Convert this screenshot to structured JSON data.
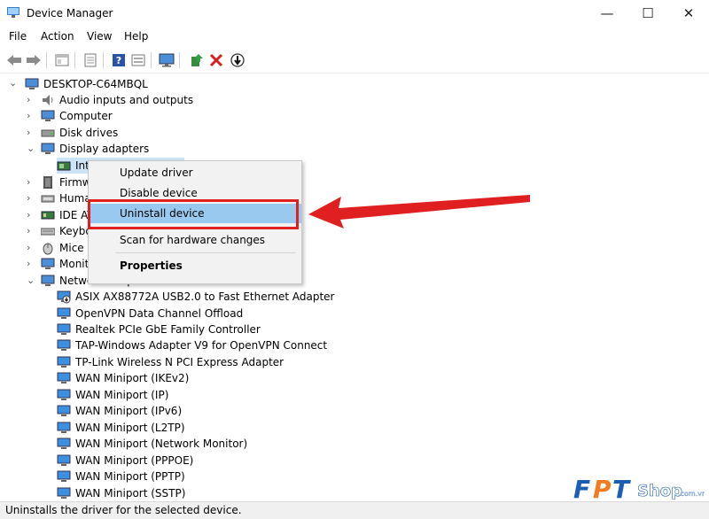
{
  "window": {
    "title": "Device Manager",
    "min_symbol": "—",
    "max_symbol": "☐",
    "close_symbol": "✕"
  },
  "menu": {
    "items": [
      "File",
      "Action",
      "View",
      "Help"
    ]
  },
  "toolbar": {
    "icons": [
      "back-icon",
      "forward-icon",
      "show-hide-tree-icon",
      "properties-icon",
      "help-icon",
      "view-icon",
      "monitor-icon",
      "update-driver-icon",
      "uninstall-icon",
      "scan-icon"
    ]
  },
  "tree": {
    "root": "DESKTOP-C64MBQL",
    "categories": [
      {
        "label": "Audio inputs and outputs"
      },
      {
        "label": "Computer"
      },
      {
        "label": "Disk drives"
      },
      {
        "label": "Display adapters"
      },
      {
        "label": "Inte"
      },
      {
        "label": "Firmw"
      },
      {
        "label": "Huma"
      },
      {
        "label": "IDE AT"
      },
      {
        "label": "Keybo"
      },
      {
        "label": "Mice a"
      },
      {
        "label": "Monit"
      },
      {
        "label": "Network adapters"
      }
    ],
    "network_devices": [
      "ASIX AX88772A USB2.0 to Fast Ethernet Adapter",
      "OpenVPN Data Channel Offload",
      "Realtek PCIe GbE Family Controller",
      "TAP-Windows Adapter V9 for OpenVPN Connect",
      "TP-Link Wireless N PCI Express Adapter",
      "WAN Miniport (IKEv2)",
      "WAN Miniport (IP)",
      "WAN Miniport (IPv6)",
      "WAN Miniport (L2TP)",
      "WAN Miniport (Network Monitor)",
      "WAN Miniport (PPPOE)",
      "WAN Miniport (PPTP)",
      "WAN Miniport (SSTP)"
    ]
  },
  "context_menu": {
    "update": "Update driver",
    "disable": "Disable device",
    "uninstall": "Uninstall device",
    "scan": "Scan for hardware changes",
    "properties": "Properties"
  },
  "status": {
    "text": "Uninstalls the driver for the selected device."
  },
  "logo": {
    "fpt": "FPT",
    "shop": "Shop",
    "domain": ".com.vn"
  },
  "colors": {
    "highlight": "#99c9ef",
    "annotation_red": "#e02020",
    "logo_blue": "#1a5fb4",
    "logo_orange": "#f47b20"
  }
}
